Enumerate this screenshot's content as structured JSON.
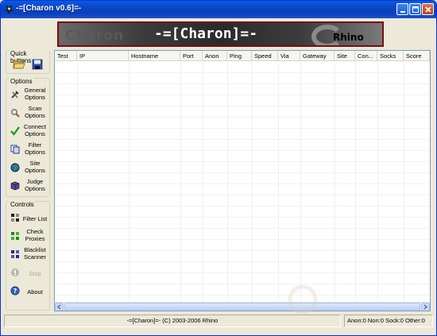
{
  "window": {
    "title": "-=[Charon v0.6]=-",
    "buttons": [
      "minimize",
      "maximize",
      "close"
    ]
  },
  "banner": {
    "ghost_text": "Charon",
    "title": "-=[Charon]=-",
    "brand": "Rhino"
  },
  "sidebar": {
    "quick_label": "Quick buttons",
    "quick_buttons": [
      {
        "icon": "open-folder-icon"
      },
      {
        "icon": "save-disk-icon"
      }
    ],
    "options_label": "Options",
    "options": [
      {
        "label": "General\nOptions",
        "icon": "tools-icon"
      },
      {
        "label": "Scan\nOptions",
        "icon": "magnifier-icon"
      },
      {
        "label": "Connect\nOptions",
        "icon": "checkmark-icon"
      },
      {
        "label": "Filter\nOptions",
        "icon": "filter-pages-icon"
      },
      {
        "label": "Site\nOptions",
        "icon": "globe-icon"
      },
      {
        "label": "Judge\nOptions",
        "icon": "cube-icon"
      }
    ],
    "controls_label": "Controls",
    "controls": [
      {
        "label": "Filter List",
        "icon": "filter-list-icon",
        "enabled": true
      },
      {
        "label": "Check\nProxies",
        "icon": "check-proxies-icon",
        "enabled": true
      },
      {
        "label": "Blacklist\nScanner",
        "icon": "blacklist-icon",
        "enabled": true
      },
      {
        "label": "Stop",
        "icon": "stop-icon",
        "enabled": false
      },
      {
        "label": "About",
        "icon": "help-icon",
        "enabled": true
      }
    ]
  },
  "table": {
    "columns": [
      "Test",
      "IP",
      "Hostname",
      "Port",
      "Anon",
      "Ping",
      "Speed",
      "Via",
      "Gateway",
      "Site",
      "Con...",
      "Socks",
      "Score"
    ],
    "rows": []
  },
  "status": {
    "main": "-=[Charon]=- (C) 2003-2006 Rhino",
    "stats": "Anon:0 Non:0 Sock:0 Other:0"
  },
  "colors": {
    "titlebar": "#0a4fd0",
    "face": "#ece9d8",
    "banner_border": "#7a0c0c",
    "list_border": "#7f9db9"
  }
}
